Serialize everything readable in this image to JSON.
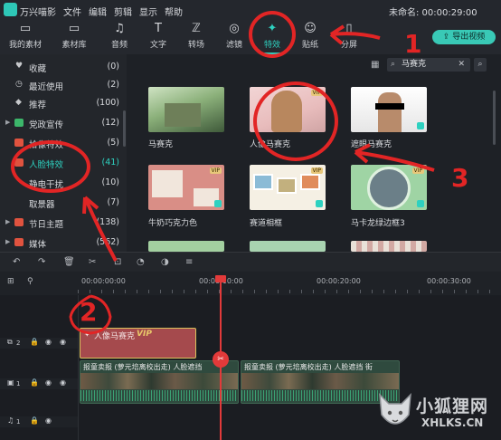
{
  "menubar": {
    "app_name": "万兴喵影",
    "menus": [
      "文件",
      "编辑",
      "剪辑",
      "显示",
      "帮助"
    ],
    "project_title": "未命名: 00:00:29:00"
  },
  "toolbar": {
    "tabs": [
      {
        "label": "我的素材",
        "icon": "folder-icon"
      },
      {
        "label": "素材库",
        "icon": "cloud-folder-icon"
      },
      {
        "label": "音频",
        "icon": "music-note-icon"
      },
      {
        "label": "文字",
        "icon": "text-icon"
      },
      {
        "label": "转场",
        "icon": "transition-icon"
      },
      {
        "label": "滤镜",
        "icon": "filter-icon"
      },
      {
        "label": "特效",
        "icon": "magic-wand-icon"
      },
      {
        "label": "贴纸",
        "icon": "sticker-icon"
      },
      {
        "label": "分屏",
        "icon": "split-screen-icon"
      }
    ],
    "active_tab": "特效",
    "export_label": "导出视频"
  },
  "sidebar": {
    "items": [
      {
        "label": "收藏",
        "count": "(0)",
        "icon": "heart-icon"
      },
      {
        "label": "最近使用",
        "count": "(2)",
        "icon": "clock-icon"
      },
      {
        "label": "推荐",
        "count": "(100)",
        "icon": "recommend-icon"
      },
      {
        "label": "党政宣传",
        "count": "(12)",
        "icon": "new-badge-icon"
      },
      {
        "label": "拾像特效",
        "count": "(5)",
        "icon": "tag-icon"
      },
      {
        "label": "人脸特效",
        "count": "(41)",
        "icon": "tag-icon"
      },
      {
        "label": "静电干扰",
        "count": "(10)",
        "icon": "tag-icon"
      },
      {
        "label": "取景器",
        "count": "(7)",
        "icon": "tag-icon"
      },
      {
        "label": "节日主题",
        "count": "(138)",
        "icon": "tag-icon"
      },
      {
        "label": "媒体",
        "count": "(562)",
        "icon": "tag-icon"
      }
    ],
    "selected": "人脸特效"
  },
  "content": {
    "search_value": "马赛克",
    "effects": [
      {
        "label": "马赛克",
        "vip": false
      },
      {
        "label": "人像马赛克",
        "vip": true
      },
      {
        "label": "遮眼马赛克",
        "vip": false
      },
      {
        "label": "牛奶巧克力色",
        "vip": true
      },
      {
        "label": "赛道相框",
        "vip": true
      },
      {
        "label": "马卡龙绿边框3",
        "vip": true
      }
    ],
    "vip_text": "VIP"
  },
  "timeline": {
    "ruler_marks": [
      "00:00:00:00",
      "00:00:10:00",
      "00:00:20:00",
      "00:00:30:00"
    ],
    "tracks": [
      {
        "index": "2",
        "type": "effect"
      },
      {
        "index": "1",
        "type": "video"
      },
      {
        "index": "1",
        "type": "audio"
      }
    ],
    "effect_clip_label": "人像马赛克",
    "effect_clip_vip": "VIP",
    "video_clip_label_1": "报童卖报 (萝元培离校出走) 人脸遮挡",
    "video_clip_label_2": "报童卖报 (萝元培离校出走) 人脸遮挡 街"
  },
  "annotations": {
    "numbers": [
      "1",
      "2",
      "3"
    ],
    "color": "#e22525"
  },
  "watermark": {
    "cn": "小狐狸网",
    "en": "XHLKS.CN"
  },
  "colors": {
    "accent": "#2ed1c0",
    "background": "#1b1d22",
    "annotation": "#e22525",
    "effect_clip": "#a54a4d"
  }
}
